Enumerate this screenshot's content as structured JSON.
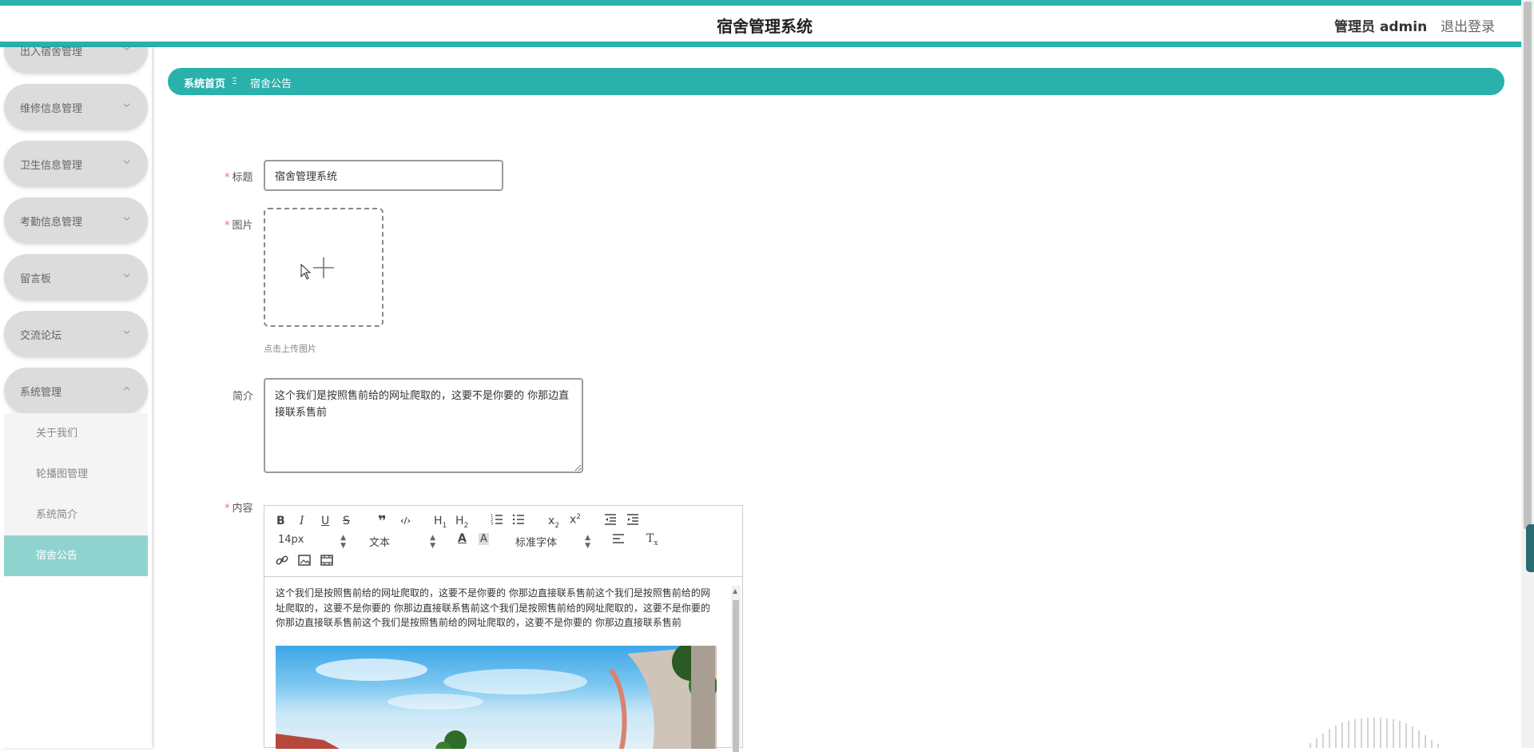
{
  "header": {
    "title": "宿舍管理系统",
    "user": "管理员 admin",
    "logout": "退出登录"
  },
  "sidebar": {
    "items": [
      {
        "label": "出入宿舍管理",
        "expanded": false
      },
      {
        "label": "维修信息管理",
        "expanded": false
      },
      {
        "label": "卫生信息管理",
        "expanded": false
      },
      {
        "label": "考勤信息管理",
        "expanded": false
      },
      {
        "label": "留言板",
        "expanded": false
      },
      {
        "label": "交流论坛",
        "expanded": false
      },
      {
        "label": "系统管理",
        "expanded": true
      }
    ],
    "subitems": [
      {
        "label": "关于我们",
        "active": false
      },
      {
        "label": "轮播图管理",
        "active": false
      },
      {
        "label": "系统简介",
        "active": false
      },
      {
        "label": "宿舍公告",
        "active": true
      }
    ]
  },
  "breadcrumb": {
    "home": "系统首页",
    "separator": "Ξ",
    "current": "宿舍公告"
  },
  "form": {
    "title_label": "标题",
    "title_value": "宿舍管理系统",
    "image_label": "图片",
    "upload_tip": "点击上传图片",
    "intro_label": "简介",
    "intro_value": "这个我们是按照售前给的网址爬取的，这要不是你要的 你那边直接联系售前",
    "content_label": "内容",
    "required_mark": "*"
  },
  "editor": {
    "font_size": "14px",
    "heading_style": "文本",
    "font_family": "标准字体",
    "content_text": "这个我们是按照售前给的网址爬取的，这要不是你要的 你那边直接联系售前这个我们是按照售前给的网址爬取的，这要不是你要的 你那边直接联系售前这个我们是按照售前给的网址爬取的，这要不是你要的 你那边直接联系售前这个我们是按照售前给的网址爬取的，这要不是你要的 你那边直接联系售前"
  },
  "colors": {
    "accent": "#2ab1ac",
    "active_submenu": "#8fd3ce",
    "required": "#f56c6c"
  }
}
